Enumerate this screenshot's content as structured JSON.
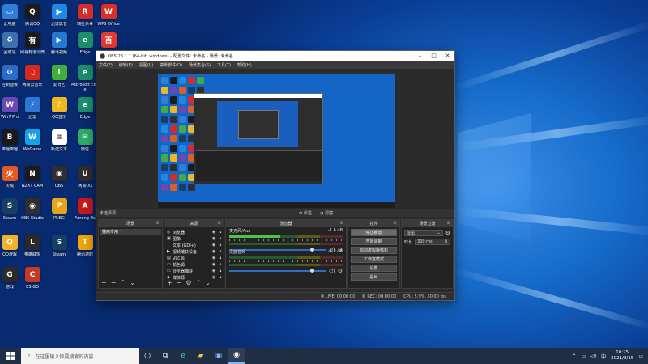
{
  "desktop_icons": [
    {
      "label": "此电脑",
      "color": "#2f7fd8",
      "glyph": "▭"
    },
    {
      "label": "腾讯QQ",
      "color": "#1b1b1b",
      "glyph": "Q"
    },
    {
      "label": "迅雷影音",
      "color": "#1e88e5",
      "glyph": "▶"
    },
    {
      "label": "瑞星杀毒",
      "color": "#d22c2c",
      "glyph": "R"
    },
    {
      "label": "WPS Office",
      "color": "#d93025",
      "glyph": "W"
    },
    {
      "label": "回收站",
      "color": "#3d6fae",
      "glyph": "♻"
    },
    {
      "label": "网易有道词典",
      "color": "#1a1a1a",
      "glyph": "有"
    },
    {
      "label": "腾讯视频",
      "color": "#2579d0",
      "glyph": "▶"
    },
    {
      "label": "Edge",
      "color": "#1b8f6b",
      "glyph": "e"
    },
    {
      "label": "百度网盘",
      "color": "#e53935",
      "glyph": "百"
    },
    {
      "label": "控制面板",
      "color": "#2b6cc9",
      "glyph": "⚙"
    },
    {
      "label": "网易云音乐",
      "color": "#d7281e",
      "glyph": "♫"
    },
    {
      "label": "爱奇艺",
      "color": "#3fae3f",
      "glyph": "i"
    },
    {
      "label": "Microsoft Edge",
      "color": "#1b8f6b",
      "glyph": "e"
    },
    {
      "label": "小白",
      "color": "#5b5b5b",
      "glyph": "□"
    },
    {
      "label": "Win7 Pro",
      "color": "#6a4ab1",
      "glyph": "W"
    },
    {
      "label": "迅雷",
      "color": "#2d76d6",
      "glyph": "⚡"
    },
    {
      "label": "QQ音乐",
      "color": "#f0b81e",
      "glyph": "♪"
    },
    {
      "label": "Edge",
      "color": "#1b8f6b",
      "glyph": "e"
    },
    {
      "label": "哔哩哔哩",
      "color": "#1a1a1a",
      "glyph": "B"
    },
    {
      "label": "WeGame",
      "color": "#14a3e6",
      "glyph": "W"
    },
    {
      "label": "新建文本",
      "color": "#ffffff",
      "glyph": "≡"
    },
    {
      "label": "微信",
      "color": "#2aae67",
      "glyph": "✉"
    },
    {
      "label": "火绒",
      "color": "#e35b22",
      "glyph": "火"
    },
    {
      "label": "NZXT CAM",
      "color": "#1b1b1b",
      "glyph": "N"
    },
    {
      "label": "OBS",
      "color": "#302e31",
      "glyph": "◉"
    },
    {
      "label": "网易UU",
      "color": "#2e2e2e",
      "glyph": "U"
    },
    {
      "label": "Steam",
      "color": "#173e64",
      "glyph": "S"
    },
    {
      "label": "OBS Studio",
      "color": "#302e31",
      "glyph": "◉"
    },
    {
      "label": "PUBG",
      "color": "#e3a51b",
      "glyph": "P"
    },
    {
      "label": "Among Us",
      "color": "#c51b1b",
      "glyph": "A"
    },
    {
      "label": "QQ游戏",
      "color": "#f2b32b",
      "glyph": "Q"
    },
    {
      "label": "英雄联盟",
      "color": "#2a2a2a",
      "glyph": "L"
    },
    {
      "label": "Steam",
      "color": "#173e64",
      "glyph": "S"
    },
    {
      "label": "腾讯游戏",
      "color": "#f0a40e",
      "glyph": "T"
    },
    {
      "label": "游戏",
      "color": "#2b2b2b",
      "glyph": "G"
    },
    {
      "label": "CS:GO",
      "color": "#c23b22",
      "glyph": "C"
    }
  ],
  "obs": {
    "title": "OBS 26.1.1 (64-bit, windows) - 配置文件: 未命名 - 场景: 未命名",
    "menu": [
      "文件(F)",
      "编辑(E)",
      "视图(V)",
      "停靠部件(D)",
      "场景集合(S)",
      "工具(T)",
      "帮助(H)"
    ],
    "context_bar": {
      "no_source": "未选择源",
      "properties": "属性",
      "filters": "滤镜"
    },
    "docks": {
      "scenes": {
        "title": "场景",
        "items": [
          "猫两专用"
        ]
      },
      "sources": {
        "title": "来源",
        "items": [
          {
            "icon": "◎",
            "name": "浏览器"
          },
          {
            "icon": "▣",
            "name": "图像"
          },
          {
            "icon": "T",
            "name": "文本 (GDI+)"
          },
          {
            "icon": "▶",
            "name": "视频捕获设备"
          },
          {
            "icon": "▤",
            "name": "VLC源"
          },
          {
            "icon": "▭",
            "name": "颜色源"
          },
          {
            "icon": "▭",
            "name": "显示器捕获"
          },
          {
            "icon": "◆",
            "name": "媒体源"
          }
        ]
      },
      "mixer": {
        "title": "混音器",
        "channels": [
          {
            "name": "麦克风/Aux",
            "db": "-1.6 dB"
          },
          {
            "name": "桌面音频",
            "db": "-4.2 dB"
          }
        ]
      },
      "transitions": {
        "title": "场景过渡",
        "type": "淡出",
        "duration_label": "时长",
        "duration": "300 ms"
      },
      "controls": {
        "title": "控件",
        "buttons": [
          "停止推流",
          "开始录制",
          "启动虚拟摄像机",
          "工作室模式",
          "设置",
          "退出"
        ]
      }
    },
    "status": {
      "live": "LIVE: 00:00:00",
      "rec": "REC: 00:00:00",
      "cpu": "CPU: 5.9%, 60.00 fps"
    }
  },
  "taskbar": {
    "search_placeholder": "在这里输入你要搜索的内容",
    "icons": [
      "cortana-icon",
      "taskview-icon",
      "edge-icon",
      "folder-icon",
      "store-icon",
      "obs-icon"
    ],
    "tray_lang": "中",
    "time": "10:25",
    "date": "2021/8/15"
  },
  "colors": {
    "accent": "#2e6fc2",
    "desktop": "#1569c8"
  }
}
